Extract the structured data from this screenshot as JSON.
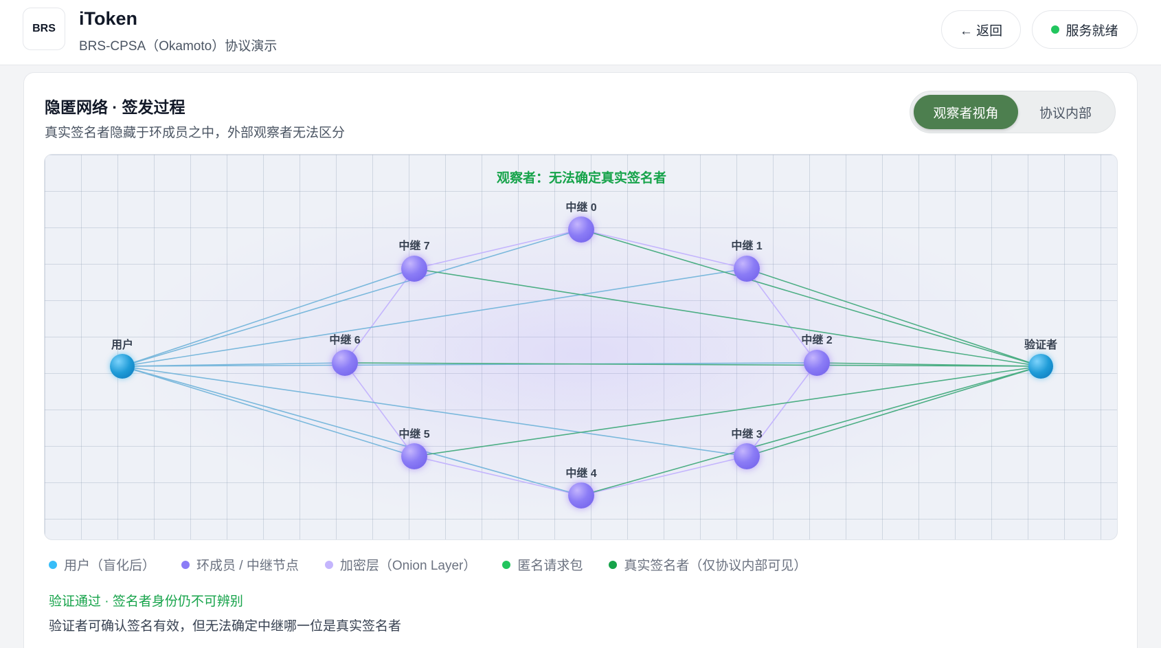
{
  "header": {
    "logo_text": "BRS",
    "title": "iToken",
    "subtitle": "BRS-CPSA（Okamoto）协议演示",
    "back_label": "← 返回",
    "status_label": "服务就绪",
    "status_color": "#22c55e"
  },
  "panel": {
    "title": "隐匿网络 · 签发过程",
    "subtitle": "真实签名者隐藏于环成员之中，外部观察者无法区分",
    "toggle": {
      "options": [
        "观察者视角",
        "协议内部"
      ],
      "selected": "观察者视角",
      "active_color": "#4d7f4f"
    }
  },
  "network": {
    "observer_message": "观察者：无法确定真实签名者",
    "nodes": {
      "user": "用户",
      "verifier": "验证者",
      "relay0": "中继 0",
      "relay1": "中继 1",
      "relay2": "中继 2",
      "relay3": "中继 3",
      "relay4": "中继 4",
      "relay5": "中继 5",
      "relay6": "中继 6",
      "relay7": "中继 7"
    },
    "colors": {
      "user_link": "#7ab8dc",
      "onion_layer": "#c4b5fd",
      "anon_packet": "#4cae84",
      "relay_node": "#8b7cf6",
      "user_node": "#1e9bd7"
    }
  },
  "legend": [
    {
      "label": "用户（盲化后）",
      "color": "#38bdf8"
    },
    {
      "label": "环成员 / 中继节点",
      "color": "#8b7cf6"
    },
    {
      "label": "加密层（Onion Layer）",
      "color": "#c4b5fd"
    },
    {
      "label": "匿名请求包",
      "color": "#22c55e"
    },
    {
      "label": "真实签名者（仅协议内部可见）",
      "color": "#16a34a"
    }
  ],
  "verification": {
    "title": "验证通过 · 签名者身份仍不可辨别",
    "description": "验证者可确认签名有效，但无法确定中继哪一位是真实签名者"
  }
}
